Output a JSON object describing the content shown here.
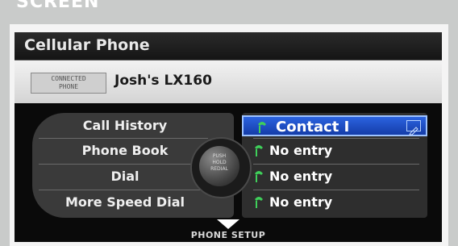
{
  "top_label": "SCREEN",
  "window": {
    "title": "Cellular Phone"
  },
  "connection": {
    "badge_line1": "CONNECTED",
    "badge_line2": "PHONE",
    "phone_name": "Josh's LX160"
  },
  "menu": {
    "items": [
      {
        "label": "Call History"
      },
      {
        "label": "Phone Book"
      },
      {
        "label": "Dial"
      },
      {
        "label": "More Speed Dial"
      }
    ]
  },
  "speed_dial": {
    "entries": [
      {
        "label": "Contact I",
        "selected": true
      },
      {
        "label": "No entry",
        "selected": false
      },
      {
        "label": "No entry",
        "selected": false
      },
      {
        "label": "No entry",
        "selected": false
      }
    ]
  },
  "knob": {
    "line1": "PUSH",
    "line2": "HOLD",
    "line3": "REDIAL"
  },
  "footer": {
    "label": "PHONE SETUP"
  },
  "colors": {
    "highlight": "#2b63e0",
    "phone_icon": "#3fd05a",
    "background": "#080808"
  },
  "icons": {
    "entry_icon": "phone-handset-icon",
    "edit_icon": "edit-icon",
    "more_icon": "down-arrow-icon"
  }
}
